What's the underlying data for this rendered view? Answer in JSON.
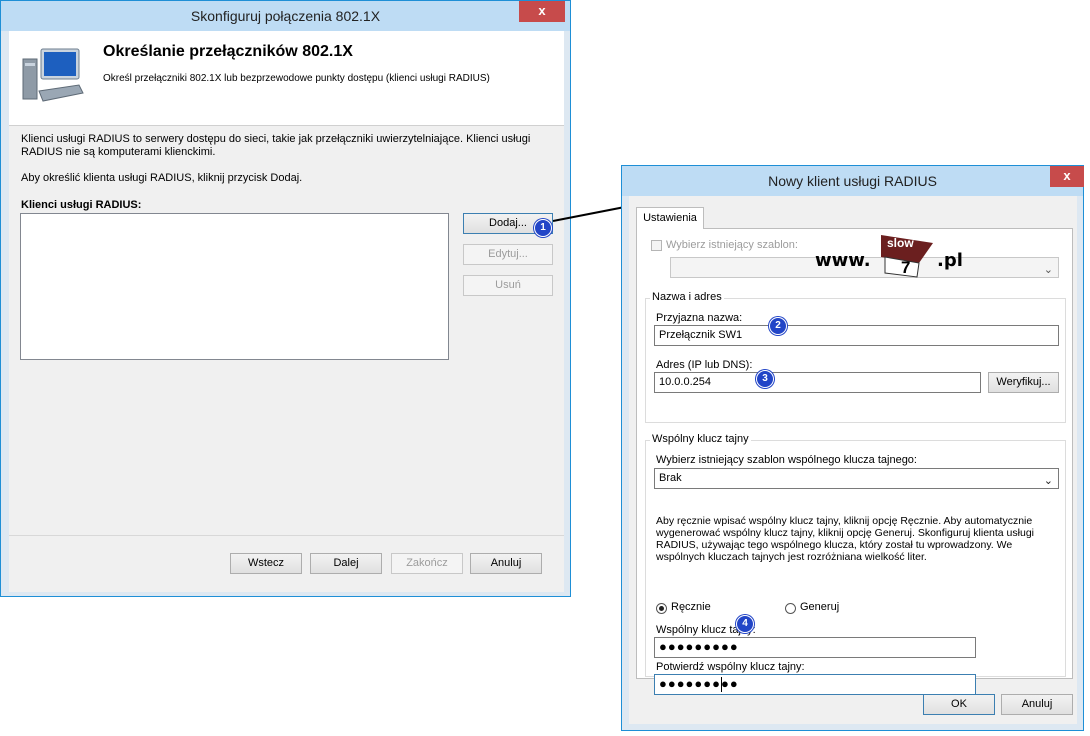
{
  "wizard": {
    "title": "Skonfiguruj połączenia 802.1X",
    "close_label": "x",
    "heading": "Określanie przełączników 802.1X",
    "subheading": "Określ przełączniki 802.1X lub bezprzewodowe punkty dostępu (klienci usługi RADIUS)",
    "desc_line1": "Klienci usługi RADIUS to serwery dostępu do sieci, takie jak przełączniki uwierzytelniające. Klienci usługi",
    "desc_line2": "RADIUS nie są komputerami klienckimi.",
    "instruction": "Aby określić klienta usługi RADIUS, kliknij przycisk Dodaj.",
    "list_label": "Klienci usługi RADIUS:",
    "buttons": {
      "add": "Dodaj...",
      "edit": "Edytuj...",
      "remove": "Usuń"
    },
    "nav": {
      "back": "Wstecz",
      "next": "Dalej",
      "finish": "Zakończ",
      "cancel": "Anuluj"
    }
  },
  "radius_dialog": {
    "title": "Nowy klient usługi RADIUS",
    "close_label": "x",
    "tab": "Ustawienia",
    "template_checkbox_label": "Wybierz istniejący szablon:",
    "watermark": {
      "prefix": "www.",
      "top": "slow",
      "number": "7",
      "suffix": ".pl"
    },
    "name_group": "Nazwa i adres",
    "friendly_name_label": "Przyjazna nazwa:",
    "friendly_name_value": "Przełącznik SW1",
    "address_label": "Adres (IP lub DNS):",
    "address_value": "10.0.0.254",
    "verify_button": "Weryfikuj...",
    "secret_group": "Wspólny klucz tajny",
    "secret_template_label": "Wybierz istniejący szablon wspólnego klucza tajnego:",
    "secret_template_value": "Brak",
    "info_line1": "Aby ręcznie wpisać wspólny klucz tajny, kliknij opcję Ręcznie. Aby automatycznie",
    "info_line2": "wygenerować wspólny klucz tajny, kliknij opcję Generuj. Skonfiguruj klienta usługi",
    "info_line3": "RADIUS, używając tego wspólnego klucza, który został tu wprowadzony. We",
    "info_line4": "wspólnych kluczach tajnych jest rozróżniana wielkość liter.",
    "radio_manual": "Ręcznie",
    "radio_generate": "Generuj",
    "shared_secret_label": "Wspólny klucz tajny:",
    "shared_secret_value": "●●●●●●●●●",
    "confirm_secret_label": "Potwierdź wspólny klucz tajny:",
    "confirm_secret_value": "●●●●●●●●●",
    "ok": "OK",
    "cancel": "Anuluj"
  },
  "callouts": [
    "1",
    "2",
    "3",
    "4"
  ],
  "colors": {
    "callout": "#2245c7",
    "close": "#c74b4b",
    "titlebar": "#bedcf4"
  }
}
